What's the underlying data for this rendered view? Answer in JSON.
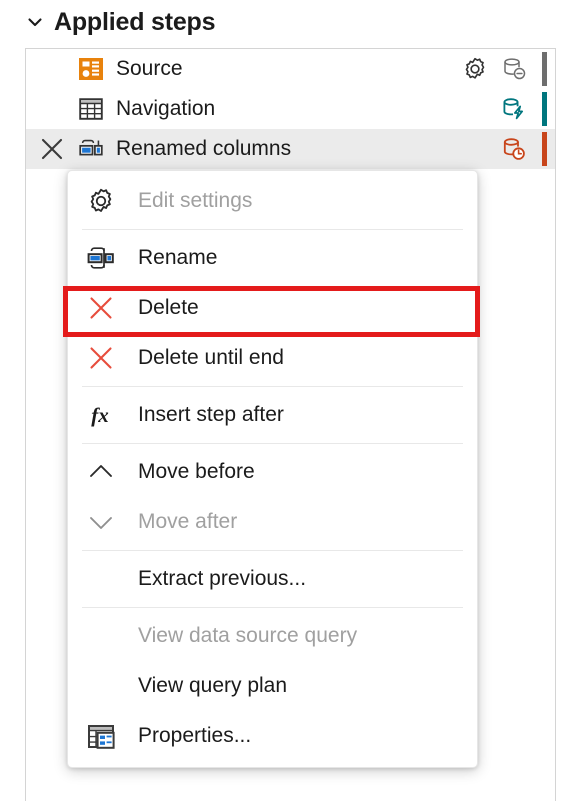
{
  "header": {
    "title": "Applied steps",
    "chevron_icon": "chevron-down-icon",
    "expanded": true
  },
  "colors": {
    "accent_orange": "#E8820C",
    "highlight_red": "#E41B1B",
    "delete_x_red": "#E74C3C",
    "status_gray": "#6E6E6E",
    "status_teal": "#00767E",
    "status_orange": "#C8451B",
    "selected_row_bg": "#EBEBEB",
    "panel_border": "#D4D4D4",
    "disabled_text": "#A0A0A0",
    "text": "#1B1B1B"
  },
  "steps": [
    {
      "label": "Source",
      "icon": "source-icon",
      "selected": false,
      "has_gear": true,
      "status_icon": "database-minus-icon",
      "status_color": "#6E6E6E"
    },
    {
      "label": "Navigation",
      "icon": "table-icon",
      "selected": false,
      "has_gear": false,
      "status_icon": "database-lightning-icon",
      "status_color": "#00767E"
    },
    {
      "label": "Renamed columns",
      "icon": "rename-columns-icon",
      "selected": true,
      "has_gear": false,
      "status_icon": "database-clock-icon",
      "status_color": "#C8451B",
      "delete_button_icon": "close-x-icon"
    }
  ],
  "context_menu": {
    "items": [
      {
        "label": "Edit settings",
        "icon": "gear-icon",
        "disabled": true,
        "separator_after": true,
        "highlighted": false
      },
      {
        "label": "Rename",
        "icon": "rename-icon",
        "disabled": false,
        "separator_after": false,
        "highlighted": false
      },
      {
        "label": "Delete",
        "icon": "delete-x-icon",
        "disabled": false,
        "separator_after": false,
        "highlighted": true
      },
      {
        "label": "Delete until end",
        "icon": "delete-x-icon",
        "disabled": false,
        "separator_after": true,
        "highlighted": false
      },
      {
        "label": "Insert step after",
        "icon": "fx-icon",
        "disabled": false,
        "separator_after": true,
        "highlighted": false
      },
      {
        "label": "Move before",
        "icon": "chevron-up-icon",
        "disabled": false,
        "separator_after": false,
        "highlighted": false
      },
      {
        "label": "Move after",
        "icon": "chevron-down-icon",
        "disabled": true,
        "separator_after": true,
        "highlighted": false
      },
      {
        "label": "Extract previous...",
        "icon": "none",
        "disabled": false,
        "separator_after": true,
        "highlighted": false
      },
      {
        "label": "View data source query",
        "icon": "none",
        "disabled": true,
        "separator_after": false,
        "highlighted": false
      },
      {
        "label": "View query plan",
        "icon": "none",
        "disabled": false,
        "separator_after": false,
        "highlighted": false
      },
      {
        "label": "Properties...",
        "icon": "properties-icon",
        "disabled": false,
        "separator_after": false,
        "highlighted": false
      }
    ]
  }
}
